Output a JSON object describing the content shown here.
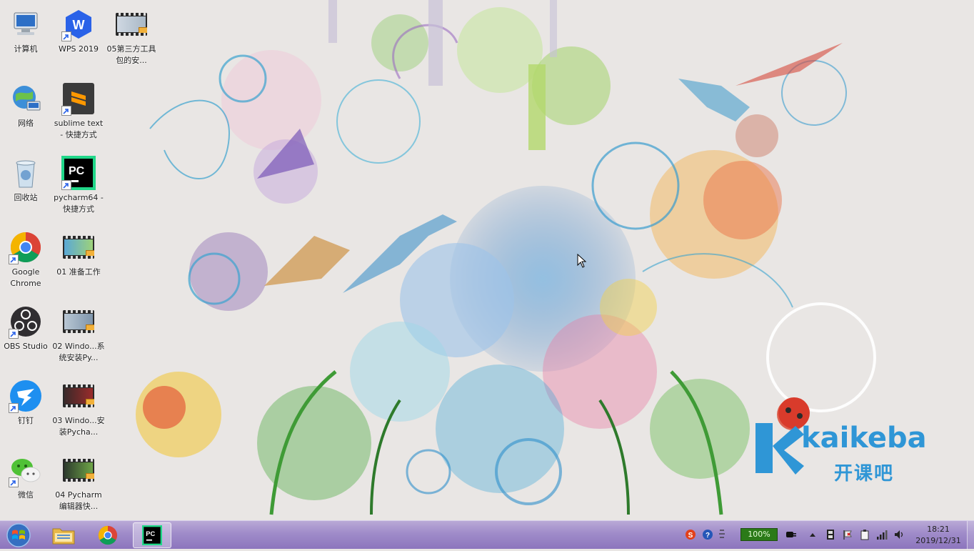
{
  "desktop": {
    "icons": [
      {
        "label": "计算机",
        "icon": "computer-icon"
      },
      {
        "label": "WPS 2019",
        "icon": "wps-icon"
      },
      {
        "label": "05第三方工具包的安...",
        "icon": "video-file-icon"
      },
      {
        "label": "网络",
        "icon": "network-icon"
      },
      {
        "label": "sublime text - 快捷方式",
        "icon": "sublime-text-icon"
      },
      {
        "label": "回收站",
        "icon": "recycle-bin-icon"
      },
      {
        "label": "pycharm64 - 快捷方式",
        "icon": "pycharm-icon"
      },
      {
        "label": "Google Chrome",
        "icon": "chrome-icon"
      },
      {
        "label": "01 准备工作",
        "icon": "video-file-icon"
      },
      {
        "label": "OBS Studio",
        "icon": "obs-icon"
      },
      {
        "label": "02 Windo...系统安装Py...",
        "icon": "video-file-icon"
      },
      {
        "label": "钉钉",
        "icon": "dingtalk-icon"
      },
      {
        "label": "03 Windo...安装Pycha...",
        "icon": "video-file-icon"
      },
      {
        "label": "微信",
        "icon": "wechat-icon"
      },
      {
        "label": "04 Pycharm编辑器快...",
        "icon": "video-file-icon"
      }
    ]
  },
  "watermark": {
    "brand_latin": "kaikeba",
    "brand_cn": "开课吧"
  },
  "taskbar": {
    "start_icon": "windows-start-icon",
    "pinned": [
      {
        "name": "explorer",
        "icon": "folder-icon",
        "active": false
      },
      {
        "name": "chrome",
        "icon": "chrome-icon",
        "active": false
      },
      {
        "name": "pycharm",
        "icon": "pycharm-icon",
        "active": true
      }
    ],
    "tray": {
      "battery": "100%",
      "time": "18:21",
      "date": "2019/12/31"
    }
  },
  "colors": {
    "taskbar": "#9f8bc9",
    "brand": "#2f96d6",
    "battery": "#2b7a18"
  }
}
